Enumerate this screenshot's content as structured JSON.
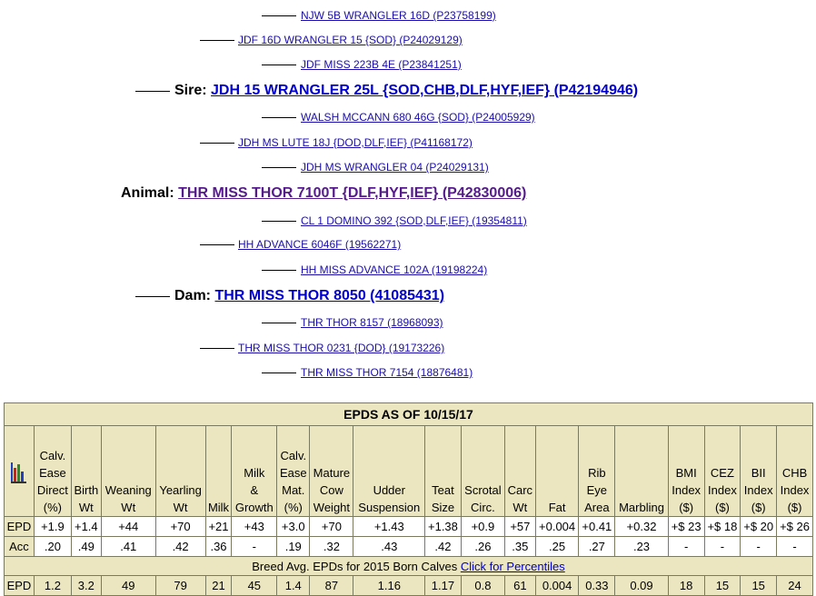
{
  "pedigree": {
    "sire_sire_sire": "NJW 5B WRANGLER 16D (P23758199)",
    "sire_sire": "JDF 16D WRANGLER 15 {SOD} (P24029129)",
    "sire_sire_dam": "JDF MISS 223B 4E (P23841251)",
    "sire_label": "Sire:",
    "sire": "JDH 15 WRANGLER 25L {SOD,CHB,DLF,HYF,IEF} (P42194946)",
    "sire_dam_sire": "WALSH MCCANN 680 46G {SOD} (P24005929)",
    "sire_dam": "JDH MS LUTE 18J {DOD,DLF,IEF} (P41168172)",
    "sire_dam_dam": "JDH MS WRANGLER 04 (P24029131)",
    "animal_label": "Animal:",
    "animal": "THR MISS THOR 7100T {DLF,HYF,IEF} (P42830006)",
    "dam_sire_sire": "CL 1 DOMINO 392 {SOD,DLF,IEF} (19354811)",
    "dam_sire": "HH ADVANCE 6046F (19562271)",
    "dam_sire_dam": "HH MISS ADVANCE 102A (19198224)",
    "dam_label": "Dam:",
    "dam": "THR MISS THOR 8050 (41085431)",
    "dam_dam_sire": "THR THOR 8157 (18968093)",
    "dam_dam": "THR MISS THOR 0231 {DOD} (19173226)",
    "dam_dam_dam": "THR MISS THOR 7154 (18876481)"
  },
  "epd_table": {
    "title": "EPDS AS OF 10/15/17",
    "icon": "bar-chart-icon",
    "columns": [
      [
        "Calv.",
        "Ease",
        "Direct",
        "(%)"
      ],
      [
        "Birth",
        "Wt"
      ],
      [
        "Weaning",
        "Wt"
      ],
      [
        "Yearling",
        "Wt"
      ],
      [
        "Milk"
      ],
      [
        "Milk",
        "&",
        "Growth"
      ],
      [
        "Calv.",
        "Ease",
        "Mat.",
        "(%)"
      ],
      [
        "Mature",
        "Cow",
        "Weight"
      ],
      [
        "Udder",
        "Suspension"
      ],
      [
        "Teat",
        "Size"
      ],
      [
        "Scrotal",
        "Circ."
      ],
      [
        "Carc",
        "Wt"
      ],
      [
        "Fat"
      ],
      [
        "Rib",
        "Eye",
        "Area"
      ],
      [
        "Marbling"
      ],
      [
        "BMI",
        "Index",
        "($)"
      ],
      [
        "CEZ",
        "Index",
        "($)"
      ],
      [
        "BII",
        "Index",
        "($)"
      ],
      [
        "CHB",
        "Index",
        "($)"
      ]
    ],
    "epd_label": "EPD",
    "epd": [
      "+1.9",
      "+1.4",
      "+44",
      "+70",
      "+21",
      "+43",
      "+3.0",
      "+70",
      "+1.43",
      "+1.38",
      "+0.9",
      "+57",
      "+0.004",
      "+0.41",
      "+0.32",
      "+$ 23",
      "+$ 18",
      "+$ 20",
      "+$ 26"
    ],
    "acc_label": "Acc",
    "acc": [
      ".20",
      ".49",
      ".41",
      ".42",
      ".36",
      "-",
      ".19",
      ".32",
      ".43",
      ".42",
      ".26",
      ".35",
      ".25",
      ".27",
      ".23",
      "-",
      "-",
      "-",
      "-"
    ],
    "breed_avg_text": "Breed Avg. EPDs for 2015 Born Calves",
    "percentiles_link": "Click for Percentiles",
    "avg_label": "EPD",
    "avg": [
      "1.2",
      "3.2",
      "49",
      "79",
      "21",
      "45",
      "1.4",
      "87",
      "1.16",
      "1.17",
      "0.8",
      "61",
      "0.004",
      "0.33",
      "0.09",
      "18",
      "15",
      "15",
      "24"
    ]
  }
}
